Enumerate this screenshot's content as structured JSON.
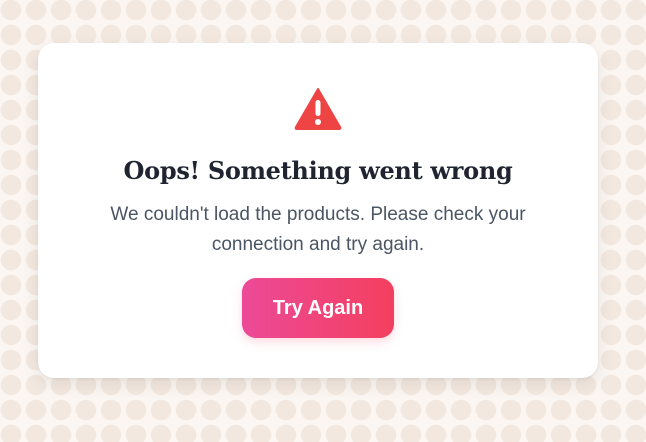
{
  "error_card": {
    "icon": "warning-triangle-icon",
    "title": "Oops! Something went wrong",
    "message": "We couldn't load the products. Please check your connection and try again.",
    "retry_label": "Try Again"
  },
  "colors": {
    "background": "#fbf6f2",
    "pattern": "#f3e8df",
    "card": "#ffffff",
    "icon": "#ef4444",
    "title": "#1f2430",
    "message": "#4b5563",
    "button_start": "#ec4a98",
    "button_end": "#f43f5e",
    "button_text": "#ffffff"
  }
}
